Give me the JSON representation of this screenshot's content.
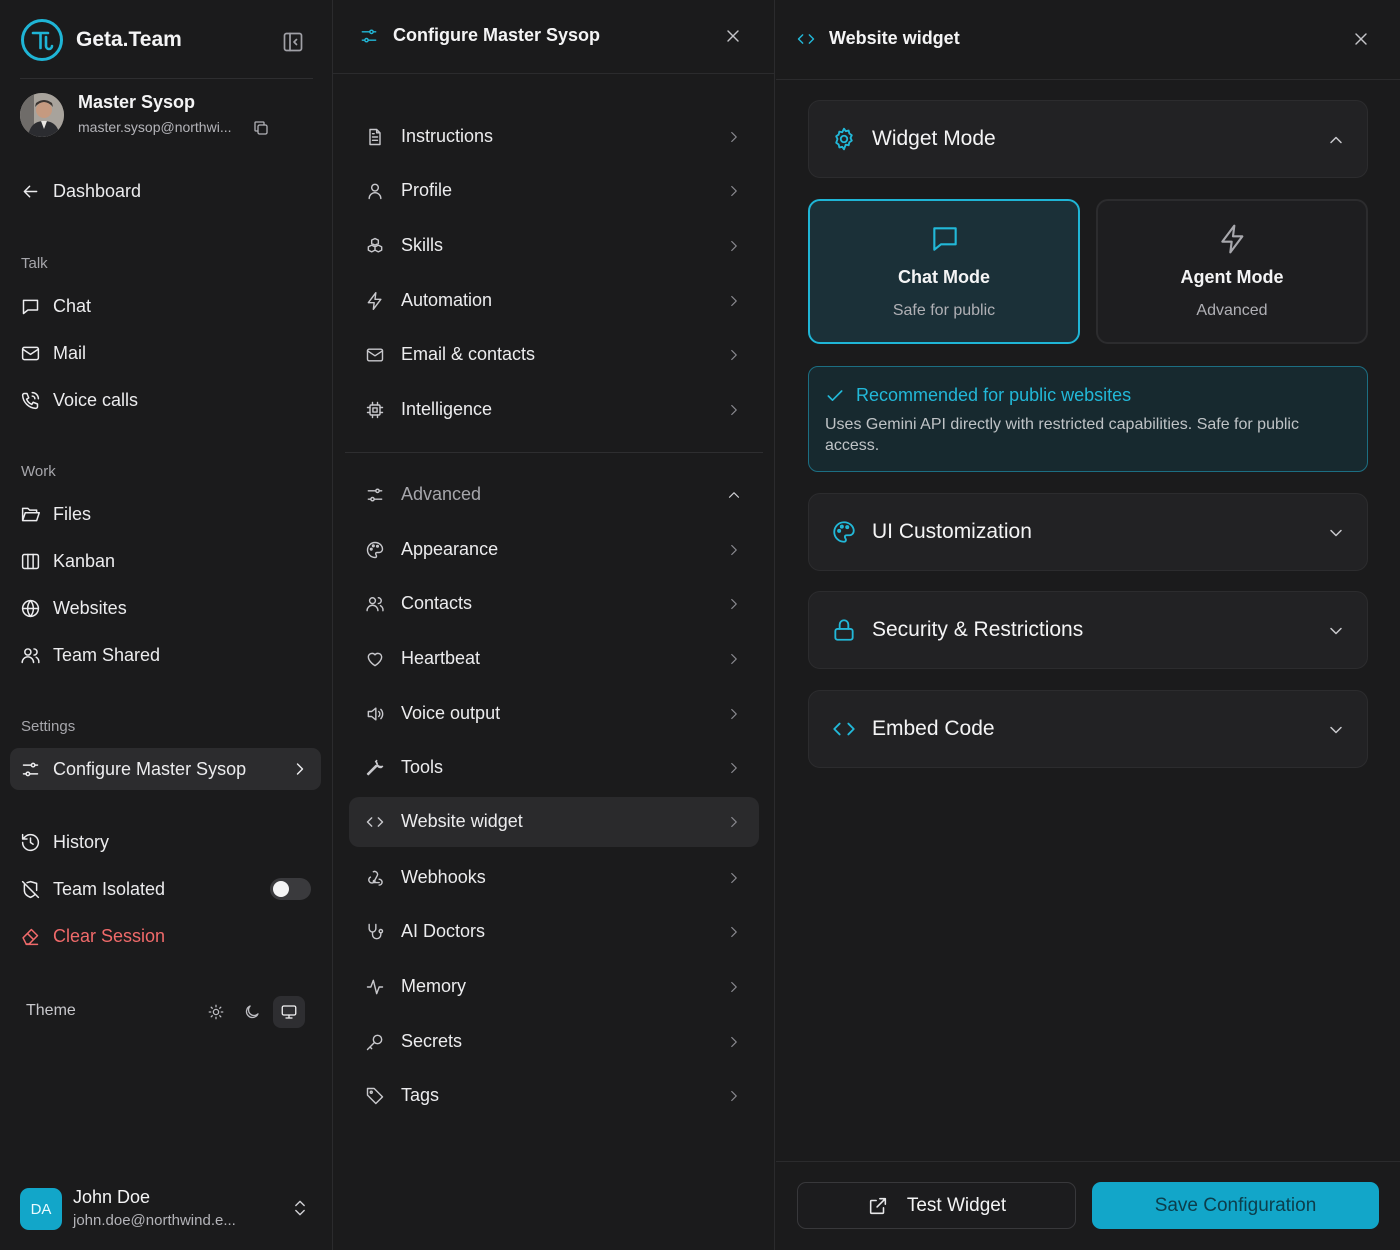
{
  "sidebar": {
    "brand": "Geta.Team",
    "profile": {
      "name": "Master Sysop",
      "email": "master.sysop@northwi..."
    },
    "dashboard": "Dashboard",
    "sections": {
      "talk": "Talk",
      "work": "Work",
      "settings": "Settings"
    },
    "talk_items": [
      "Chat",
      "Mail",
      "Voice calls"
    ],
    "work_items": [
      "Files",
      "Kanban",
      "Websites",
      "Team Shared"
    ],
    "configure": "Configure Master Sysop",
    "history": "History",
    "team_isolated": "Team Isolated",
    "team_isolated_on": false,
    "clear_session": "Clear Session",
    "theme": {
      "label": "Theme",
      "selected": "system"
    },
    "user": {
      "initials": "DA",
      "name": "John Doe",
      "email": "john.doe@northwind.e..."
    }
  },
  "config_panel": {
    "title": "Configure Master Sysop",
    "items": [
      "Instructions",
      "Profile",
      "Skills",
      "Automation",
      "Email & contacts",
      "Intelligence"
    ],
    "advanced": "Advanced",
    "advanced_items": [
      "Appearance",
      "Contacts",
      "Heartbeat",
      "Voice output",
      "Tools",
      "Website widget",
      "Webhooks",
      "AI Doctors",
      "Memory",
      "Secrets",
      "Tags"
    ],
    "active_item": "Website widget"
  },
  "widget_panel": {
    "title": "Website widget",
    "widget_mode": {
      "title": "Widget Mode",
      "modes": [
        {
          "name": "Chat Mode",
          "desc": "Safe for public",
          "selected": true
        },
        {
          "name": "Agent Mode",
          "desc": "Advanced",
          "selected": false
        }
      ],
      "recommend_title": "Recommended for public websites",
      "recommend_text": "Uses Gemini API directly with restricted capabilities. Safe for public access."
    },
    "sections": [
      "UI Customization",
      "Security & Restrictions",
      "Embed Code"
    ],
    "test_button": "Test Widget",
    "save_button": "Save Configuration"
  },
  "colors": {
    "accent": "#22b8d8",
    "danger": "#f06a6a",
    "background": "#1b1b1c"
  }
}
